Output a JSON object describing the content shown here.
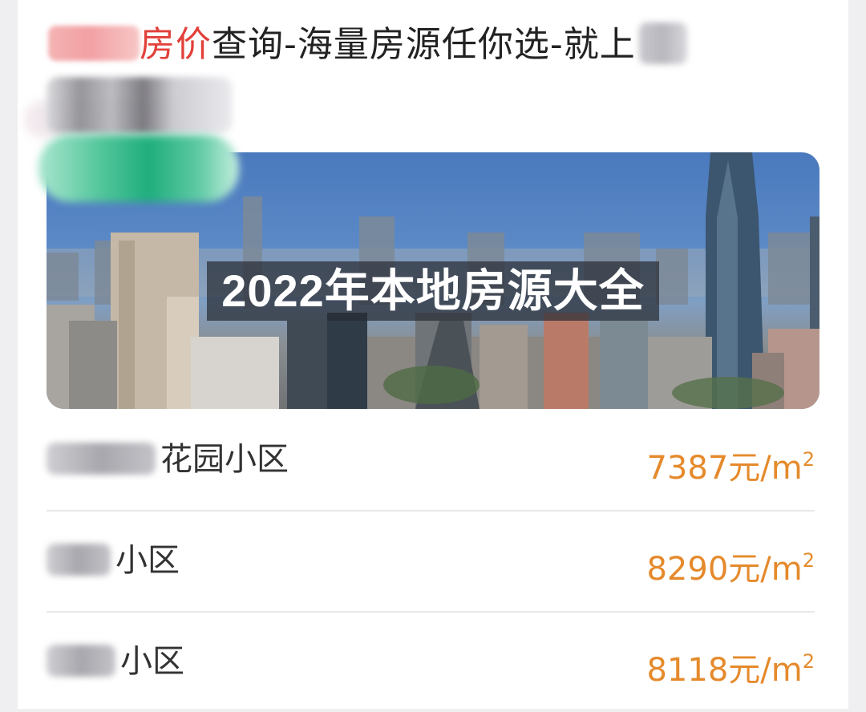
{
  "headline": {
    "highlight": "房价",
    "rest": "查询-海量房源任你选-就上"
  },
  "banner": {
    "title": "2022年本地房源大全"
  },
  "listings": [
    {
      "name_suffix": "花园小区",
      "price": "7387",
      "unit": "元/m",
      "unit_sup": "2"
    },
    {
      "name_suffix": "小区",
      "price": "8290",
      "unit": "元/m",
      "unit_sup": "2"
    },
    {
      "name_suffix": "小区",
      "price": "8118",
      "unit": "元/m",
      "unit_sup": "2"
    }
  ],
  "colors": {
    "accent_red": "#e2403a",
    "price_orange": "#e58a2c"
  }
}
